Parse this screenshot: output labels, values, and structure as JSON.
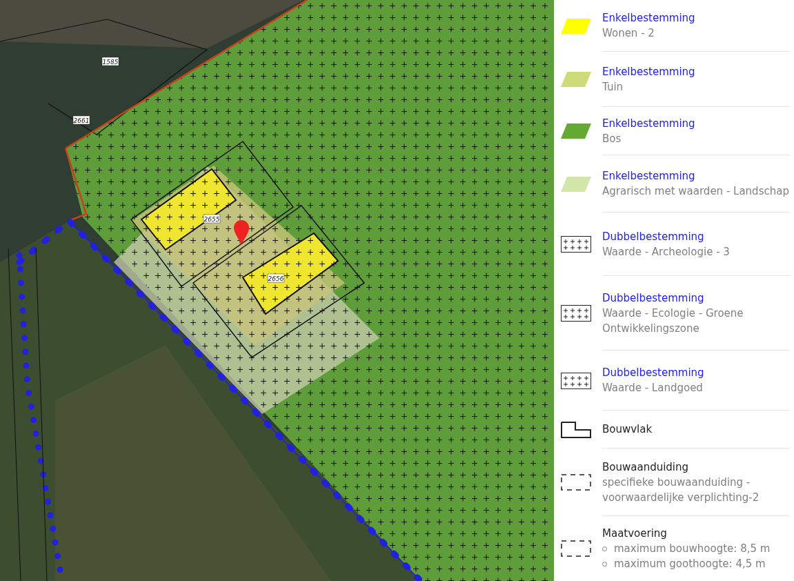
{
  "map": {
    "parcels": [
      "1585",
      "2661",
      "2655",
      "2656"
    ]
  },
  "legend": [
    {
      "kind": "fill",
      "color": "#ffff00",
      "link": true,
      "title": "Enkelbestemming",
      "subtitle": "Wonen - 2"
    },
    {
      "kind": "fill",
      "color": "#cddc78",
      "link": true,
      "title": "Enkelbestemming",
      "subtitle": "Tuin"
    },
    {
      "kind": "fill",
      "color": "#64aa32",
      "link": true,
      "title": "Enkelbestemming",
      "subtitle": "Bos"
    },
    {
      "kind": "fill",
      "color": "#d2e6aa",
      "link": true,
      "title": "Enkelbestemming",
      "subtitle": "Agrarisch met waarden - Landschap"
    },
    {
      "kind": "hatch",
      "link": true,
      "title": "Dubbelbestemming",
      "subtitle": "Waarde - Archeologie - 3"
    },
    {
      "kind": "hatch",
      "link": true,
      "title": "Dubbelbestemming",
      "subtitle": "Waarde - Ecologie - Groene Ontwikkelingszone"
    },
    {
      "kind": "hatch",
      "link": true,
      "title": "Dubbelbestemming",
      "subtitle": "Waarde - Landgoed"
    },
    {
      "kind": "outline",
      "link": false,
      "title": "Bouwvlak"
    },
    {
      "kind": "dashed",
      "link": false,
      "title": "Bouwaanduiding",
      "subtitle": "specifieke bouwaanduiding - voorwaardelijke verplichting-2"
    },
    {
      "kind": "dashed",
      "link": false,
      "title": "Maatvoering",
      "values": [
        "maximum bouwhoogte: 8,5 m",
        "maximum goothoogte: 4,5 m"
      ]
    }
  ]
}
